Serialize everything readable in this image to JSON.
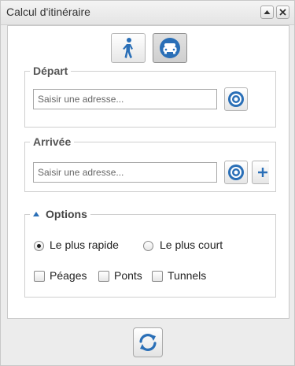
{
  "window": {
    "title": "Calcul d'itinéraire",
    "collapse_icon": "triangle-up-icon",
    "close_icon": "close-icon"
  },
  "modes": [
    {
      "name": "pedestrian",
      "icon": "walking-person-icon",
      "active": false
    },
    {
      "name": "car",
      "icon": "car-icon",
      "active": true
    }
  ],
  "departure": {
    "legend": "Départ",
    "placeholder": "Saisir une adresse...",
    "locate_icon": "target-icon"
  },
  "arrival": {
    "legend": "Arrivée",
    "placeholder": "Saisir une adresse...",
    "locate_icon": "target-icon",
    "add_icon": "plus-icon"
  },
  "options": {
    "legend": "Options",
    "toggle_icon": "triangle-up-icon",
    "route_types": [
      {
        "label": "Le plus rapide",
        "selected": true
      },
      {
        "label": "Le plus court",
        "selected": false
      }
    ],
    "avoid": [
      {
        "label": "Péages",
        "checked": false
      },
      {
        "label": "Ponts",
        "checked": false
      },
      {
        "label": "Tunnels",
        "checked": false
      }
    ]
  },
  "footer": {
    "refresh_icon": "refresh-icon"
  },
  "colors": {
    "accent": "#2a6fb7",
    "panel_bg": "#ffffff",
    "window_bg": "#ececec"
  }
}
